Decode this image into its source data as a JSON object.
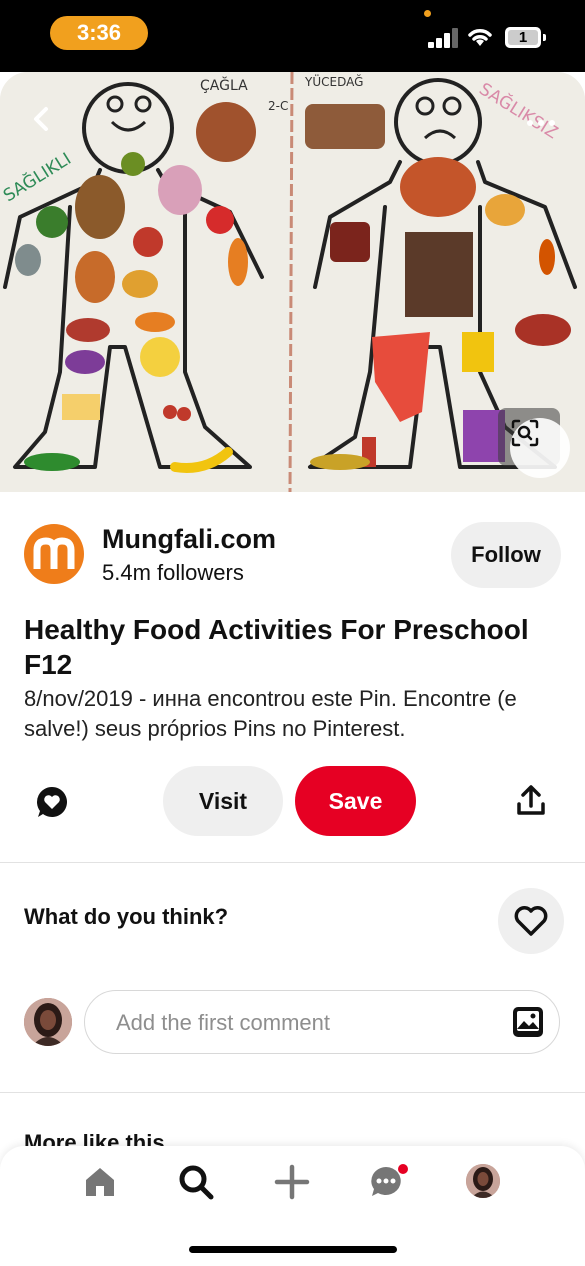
{
  "status_bar": {
    "time": "3:36",
    "battery_level": "1"
  },
  "pin": {
    "image_alt": "Children's drawing of two bodies filled with healthy and unhealthy food cutouts",
    "image_labels": {
      "left_name": "ÇAĞLA",
      "right_name": "YÜCEDAĞ",
      "class_label": "2-C",
      "left_word": "SAĞLIKLI",
      "right_word": "SAĞLIKSIZ"
    }
  },
  "profile": {
    "name": "Mungfali.com",
    "followers": "5.4m followers",
    "follow_label": "Follow",
    "logo_letter": "m"
  },
  "title": "Healthy Food Activities For Preschool F12",
  "description": "8/nov/2019 - инна encontrou este Pin. Encontre (e salve!) seus próprios Pins no Pinterest.",
  "actions": {
    "visit_label": "Visit",
    "save_label": "Save"
  },
  "comments": {
    "prompt": "What do you think?",
    "placeholder": "Add the first comment"
  },
  "more_like_this": "More like this",
  "colors": {
    "save": "#e60023",
    "logo": "#ef7d1a",
    "status_pill": "#f1a01e",
    "notification_dot": "#e60023"
  }
}
